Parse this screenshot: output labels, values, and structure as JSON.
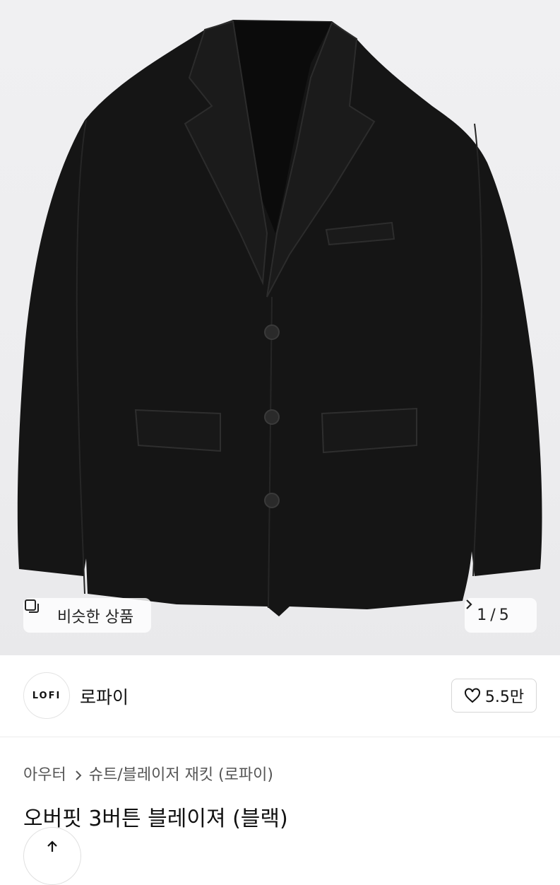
{
  "gallery": {
    "similar_label": "비슷한 상품",
    "page_current": "1",
    "page_sep": "/",
    "page_total": "5"
  },
  "shop": {
    "logo_text": "LOFI",
    "name": "로파이",
    "like_count": "5.5만"
  },
  "breadcrumb": {
    "level1": "아우터",
    "level2": "슈트/블레이저 재킷 (로파이)"
  },
  "product": {
    "title": "오버핏 3버튼 블레이져 (블랙)"
  },
  "icons": [
    "similar-products-icon",
    "chevron-right-icon",
    "heart-icon",
    "share-icon"
  ],
  "colors": {
    "image_bg": "#eeeef0",
    "jacket": "#141414",
    "border": "#d6d6d6"
  }
}
